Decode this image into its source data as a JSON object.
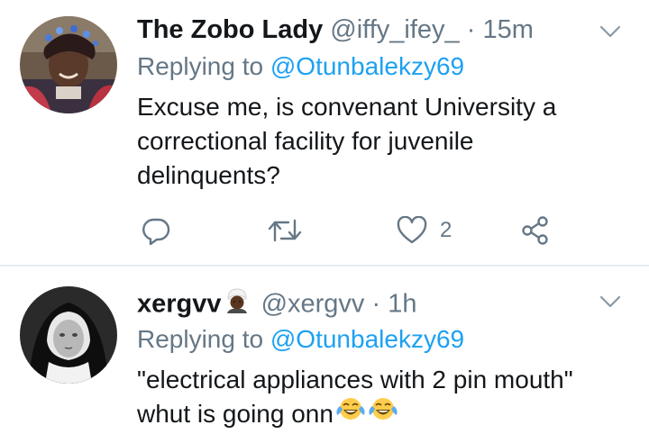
{
  "tweets": [
    {
      "display_name": "The Zobo Lady",
      "handle": "@iffy_ifey_",
      "separator": "·",
      "time": "15m",
      "reply_prefix": "Replying to",
      "reply_handle": "@Otunbalekzy69",
      "body_lines": [
        "Excuse me, is convenant University a",
        "correctional facility for juvenile",
        "delinquents?"
      ],
      "like_count": "2"
    },
    {
      "display_name": "xergvv",
      "handle": "@xergvv",
      "separator": "·",
      "time": "1h",
      "reply_prefix": "Replying to",
      "reply_handle": "@Otunbalekzy69",
      "body_lines": [
        "\"electrical appliances with 2 pin mouth\"",
        "whut is going onn"
      ]
    }
  ],
  "colors": {
    "link": "#1da1f2",
    "secondary_text": "#657786",
    "primary_text": "#14171a",
    "divider": "#e6ecf0"
  },
  "icons": [
    "chevron-down-icon",
    "reply-icon",
    "retweet-icon",
    "like-icon",
    "share-icon",
    "face-with-tears-of-joy-emoji",
    "person-with-turban-emoji"
  ]
}
